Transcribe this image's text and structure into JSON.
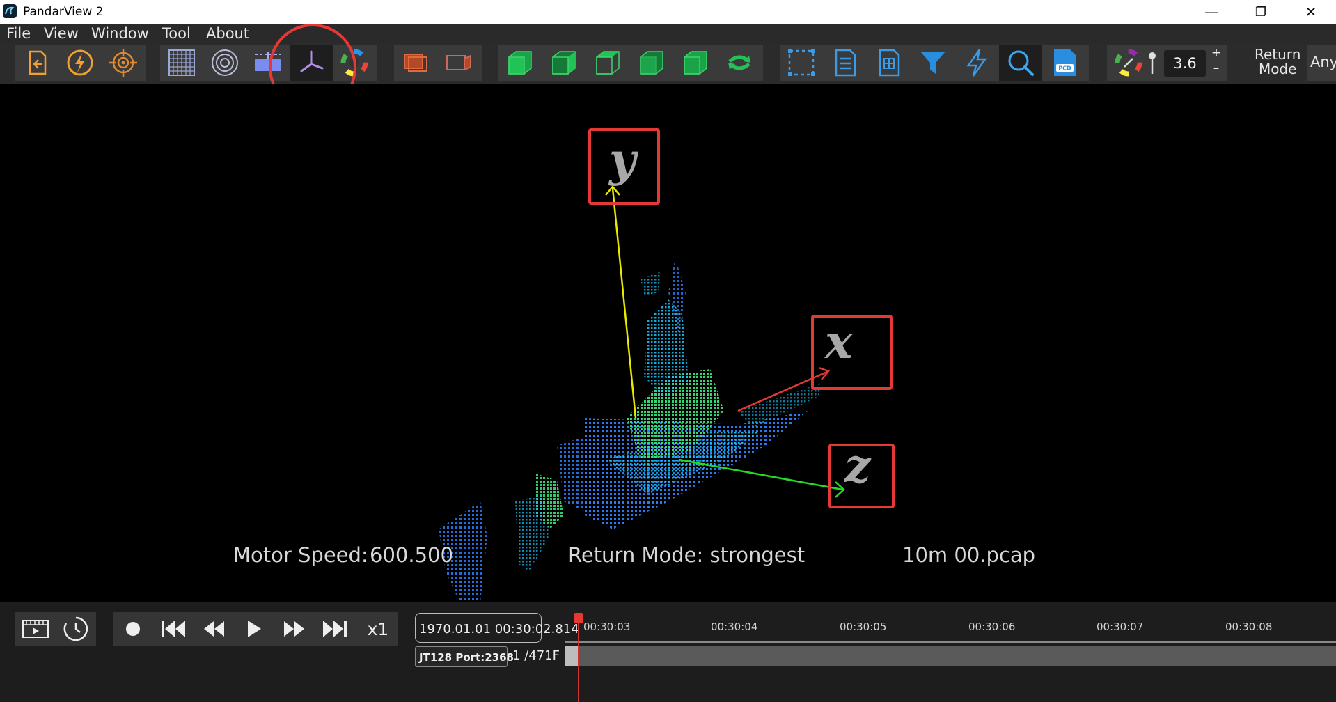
{
  "window": {
    "title": "PandarView 2",
    "controls": {
      "minimize": "—",
      "restore": "❐",
      "close": "✕"
    }
  },
  "menu": [
    "File",
    "View",
    "Window",
    "Tool",
    "About"
  ],
  "toolbar": {
    "point_size_value": "3.6",
    "stepper_plus": "+",
    "stepper_minus": "–",
    "return_mode_label_line1": "Return",
    "return_mode_label_line2": "Mode",
    "return_mode_value": "Any",
    "pcd_label": "PCD",
    "icons": [
      "open-file-icon",
      "connect-lightning-icon",
      "target-icon",
      "grid-icon",
      "rings-icon",
      "ground-plane-icon",
      "axis-icon",
      "color-wheel-icon",
      "view-layer-icon",
      "view-box-icon",
      "front-view-cube-icon",
      "side-view-cube-icon",
      "top-view-cube-icon",
      "left-view-cube-icon",
      "right-view-cube-icon",
      "rotate-view-icon",
      "selection-box-icon",
      "list-document-icon",
      "table-document-icon",
      "filter-icon",
      "flash-icon",
      "search-icon",
      "pcd-export-icon",
      "palette-icon",
      "point-size-icon"
    ]
  },
  "viewport": {
    "motor_speed_label": "Motor Speed:",
    "motor_speed_value": "600.500",
    "return_mode_text": "Return Mode: strongest",
    "file_name": "10m 00.pcap",
    "axis_labels": {
      "y": "y",
      "x": "x",
      "z": "z"
    },
    "axis_colors": {
      "x": "#e53935",
      "y": "#e8e800",
      "z": "#22dd22"
    },
    "annotation_color": "#e53935"
  },
  "playback": {
    "speed": "x1",
    "timestamp": "1970.01.01 00:30:02.814",
    "device_port": "JT128 Port:2368",
    "frame_counter": "1 /471F",
    "timeline_ticks": [
      "00:30:03",
      "00:30:04",
      "00:30:05",
      "00:30:06",
      "00:30:07",
      "00:30:08"
    ]
  }
}
